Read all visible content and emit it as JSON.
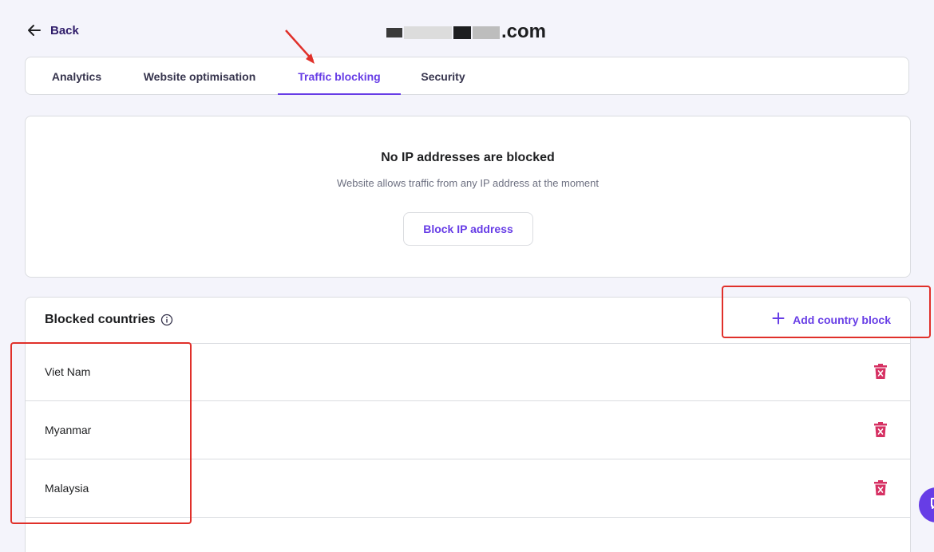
{
  "header": {
    "back_label": "Back",
    "site_domain": ".com"
  },
  "tabs": [
    {
      "label": "Analytics",
      "active": false
    },
    {
      "label": "Website optimisation",
      "active": false
    },
    {
      "label": "Traffic blocking",
      "active": true
    },
    {
      "label": "Security",
      "active": false
    }
  ],
  "ip_block": {
    "title": "No IP addresses are blocked",
    "subtitle": "Website allows traffic from any IP address at the moment",
    "button_label": "Block IP address"
  },
  "countries": {
    "title": "Blocked countries",
    "info_icon": "info-icon",
    "add_label": "Add country block",
    "items": [
      {
        "name": "Viet Nam"
      },
      {
        "name": "Myanmar"
      },
      {
        "name": "Malaysia"
      }
    ]
  },
  "colors": {
    "accent": "#673de6",
    "danger": "#d63163",
    "annotation": "#e0302a"
  }
}
